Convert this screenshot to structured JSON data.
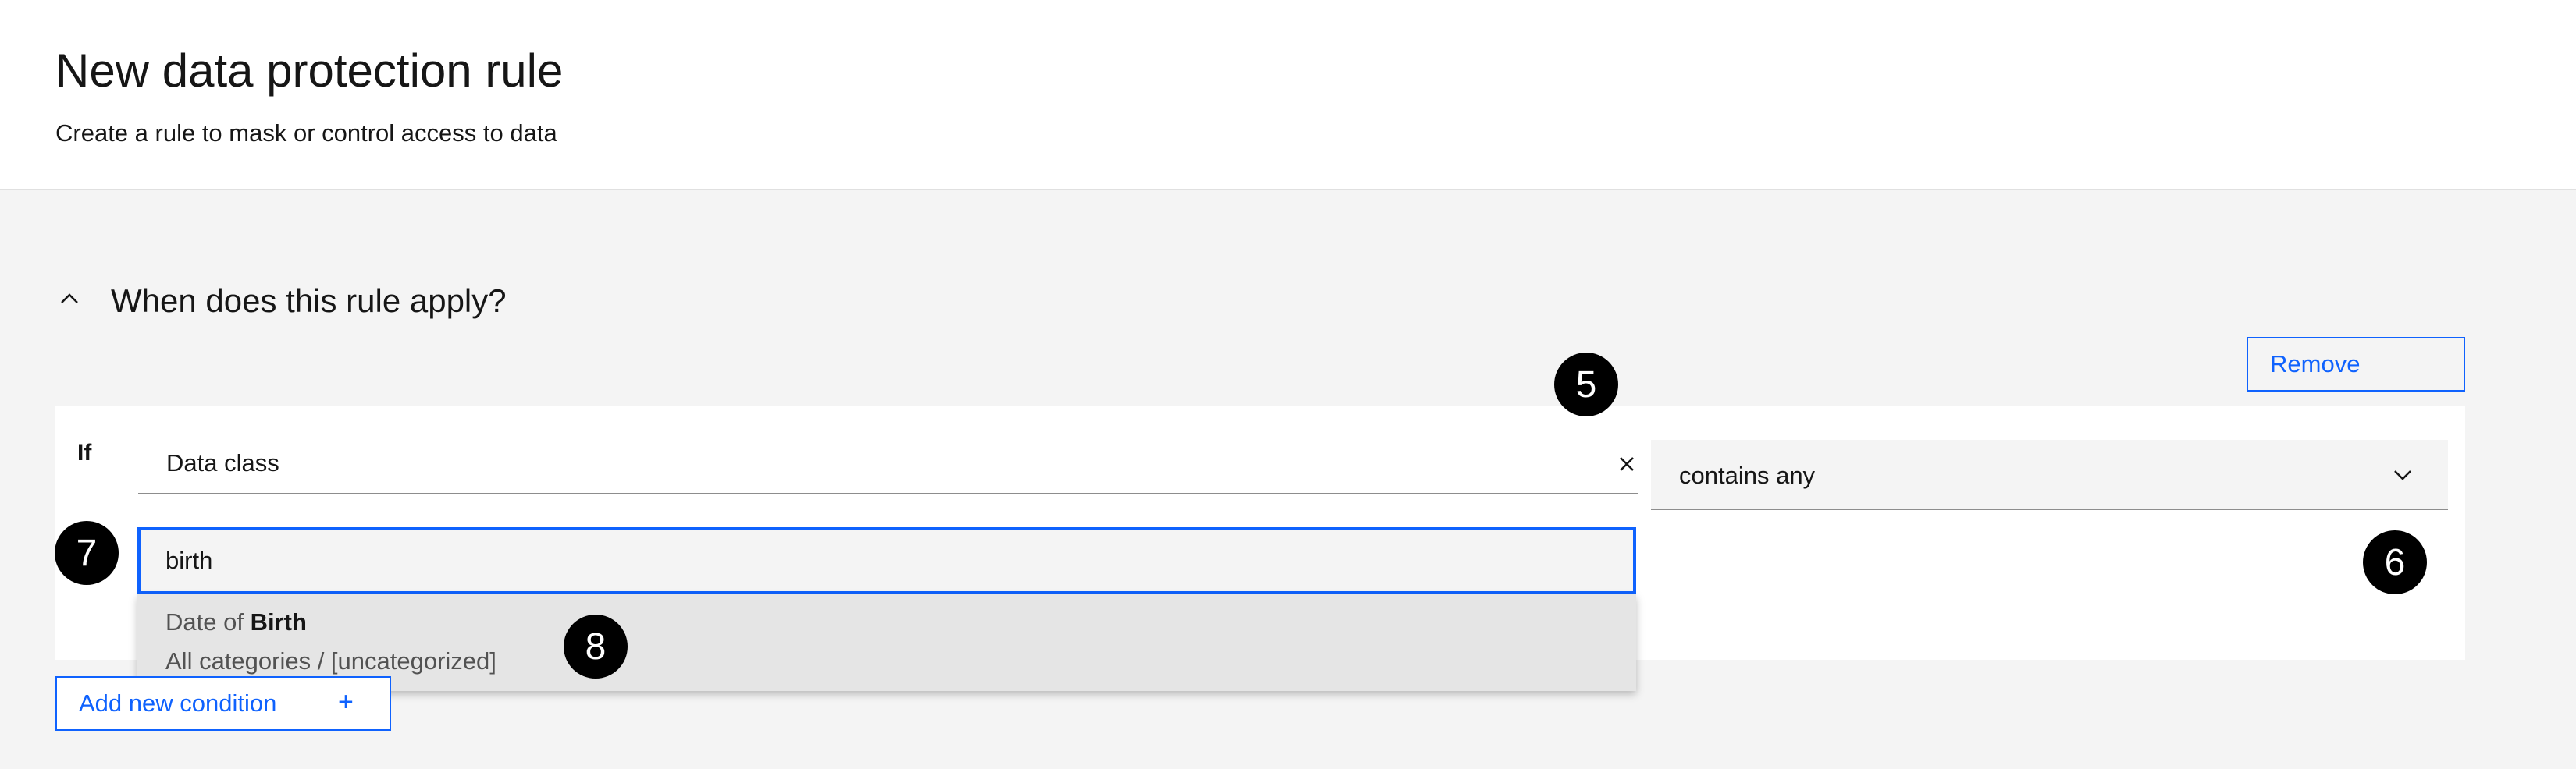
{
  "header": {
    "title": "New data protection rule",
    "subtitle": "Create a rule to mask or control access to data"
  },
  "section": {
    "title": "When does this rule apply?",
    "toggle_icon": "chevron-up-icon"
  },
  "buttons": {
    "remove": "Remove",
    "add_condition": "Add new condition",
    "add_condition_icon": "+"
  },
  "condition": {
    "if_label": "If",
    "field_value": "Data class",
    "operator_value": "contains any",
    "search_value": "birth"
  },
  "suggestion": {
    "prefix": "Date of ",
    "match": "Birth",
    "path": "All categories / [uncategorized]"
  },
  "annotations": [
    "5",
    "6",
    "7",
    "8"
  ],
  "colors": {
    "accent": "#0f62fe",
    "page_background": "#f4f4f4",
    "card_background": "#ffffff",
    "suggestion_background": "#e5e5e5",
    "badge": "#000000"
  }
}
